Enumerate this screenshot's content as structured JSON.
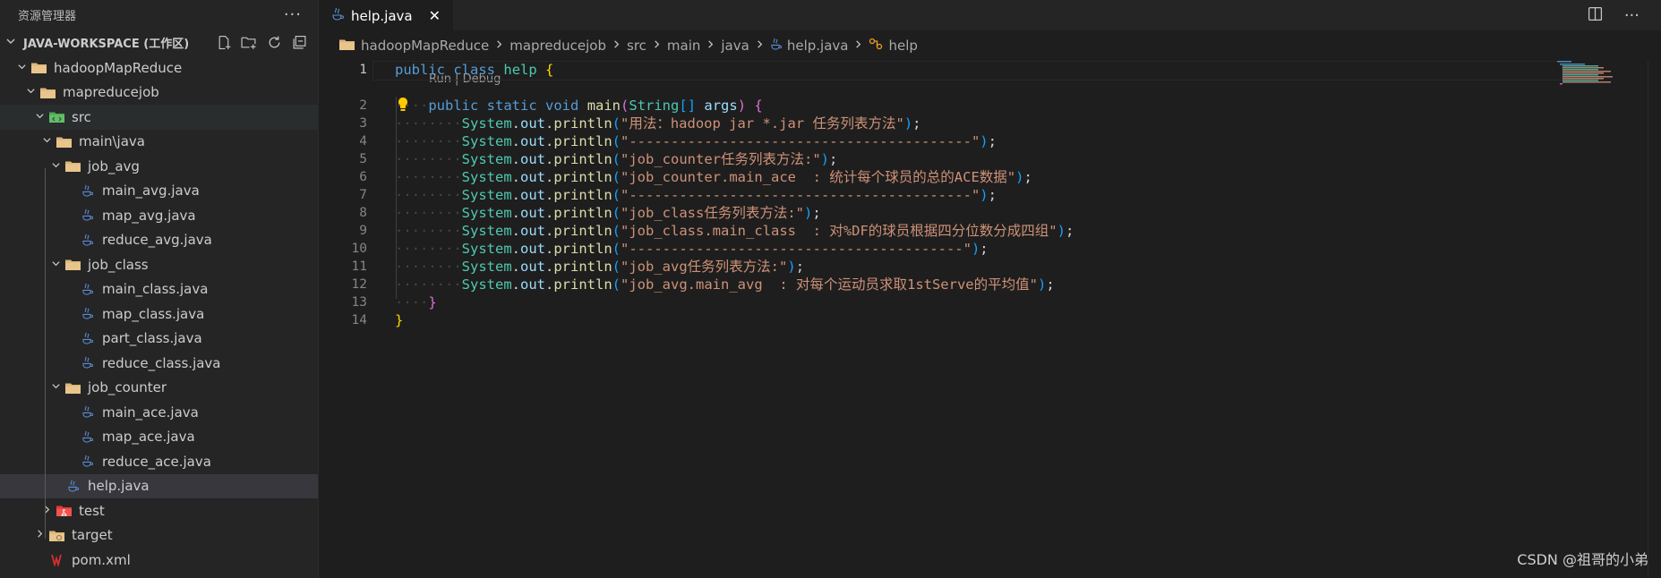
{
  "sidebar": {
    "title": "资源管理器",
    "more": "···",
    "workspace": "JAVA-WORKSPACE (工作区)",
    "tree": [
      {
        "label": "hadoopMapReduce",
        "depth": 0,
        "chevron": "open",
        "icon": "folder-icon"
      },
      {
        "label": "mapreducejob",
        "depth": 1,
        "chevron": "open",
        "icon": "folder-icon"
      },
      {
        "label": "src",
        "depth": 2,
        "chevron": "open",
        "icon": "folder-src-icon"
      },
      {
        "label": "main\\java",
        "depth": 3,
        "chevron": "open",
        "icon": "folder-icon"
      },
      {
        "label": "job_avg",
        "depth": 4,
        "chevron": "open",
        "icon": "folder-icon"
      },
      {
        "label": "main_avg.java",
        "depth": 5,
        "chevron": "",
        "icon": "java-icon"
      },
      {
        "label": "map_avg.java",
        "depth": 5,
        "chevron": "",
        "icon": "java-icon"
      },
      {
        "label": "reduce_avg.java",
        "depth": 5,
        "chevron": "",
        "icon": "java-icon"
      },
      {
        "label": "job_class",
        "depth": 4,
        "chevron": "open",
        "icon": "folder-icon"
      },
      {
        "label": "main_class.java",
        "depth": 5,
        "chevron": "",
        "icon": "java-icon"
      },
      {
        "label": "map_class.java",
        "depth": 5,
        "chevron": "",
        "icon": "java-icon"
      },
      {
        "label": "part_class.java",
        "depth": 5,
        "chevron": "",
        "icon": "java-icon"
      },
      {
        "label": "reduce_class.java",
        "depth": 5,
        "chevron": "",
        "icon": "java-icon"
      },
      {
        "label": "job_counter",
        "depth": 4,
        "chevron": "open",
        "icon": "folder-icon"
      },
      {
        "label": "main_ace.java",
        "depth": 5,
        "chevron": "",
        "icon": "java-icon"
      },
      {
        "label": "map_ace.java",
        "depth": 5,
        "chevron": "",
        "icon": "java-icon"
      },
      {
        "label": "reduce_ace.java",
        "depth": 5,
        "chevron": "",
        "icon": "java-icon"
      },
      {
        "label": "help.java",
        "depth": 4,
        "chevron": "",
        "icon": "java-icon",
        "selected": true
      },
      {
        "label": "test",
        "depth": 3,
        "chevron": "closed",
        "icon": "folder-test-icon"
      },
      {
        "label": "target",
        "depth": 2,
        "chevron": "closed",
        "icon": "folder-target-icon"
      },
      {
        "label": "pom.xml",
        "depth": 2,
        "chevron": "",
        "icon": "maven-icon"
      }
    ]
  },
  "editor": {
    "tab": {
      "label": "help.java",
      "close": "✕"
    },
    "breadcrumb": [
      "hadoopMapReduce",
      "mapreducejob",
      "src",
      "main",
      "java",
      "help.java",
      "help"
    ],
    "codelens": "Run | Debug",
    "lines": [
      {
        "n": "1",
        "tokens": [
          [
            "kw",
            "public"
          ],
          [
            "pn",
            " "
          ],
          [
            "kw",
            "class"
          ],
          [
            "pn",
            " "
          ],
          [
            "ty",
            "help"
          ],
          [
            "pn",
            " "
          ],
          [
            "br1",
            "{"
          ]
        ]
      },
      {
        "n": "2",
        "tokens": [
          [
            "dots",
            "····"
          ],
          [
            "kw",
            "public"
          ],
          [
            "pn",
            " "
          ],
          [
            "kw",
            "static"
          ],
          [
            "pn",
            " "
          ],
          [
            "kw",
            "void"
          ],
          [
            "pn",
            " "
          ],
          [
            "fn",
            "main"
          ],
          [
            "br2",
            "("
          ],
          [
            "ty",
            "String"
          ],
          [
            "br3",
            "[]"
          ],
          [
            "pn",
            " "
          ],
          [
            "var",
            "args"
          ],
          [
            "br2",
            ")"
          ],
          [
            "pn",
            " "
          ],
          [
            "br2",
            "{"
          ]
        ]
      },
      {
        "n": "3",
        "tokens": [
          [
            "dots",
            "········"
          ],
          [
            "ty",
            "System"
          ],
          [
            "pn",
            "."
          ],
          [
            "var",
            "out"
          ],
          [
            "pn",
            "."
          ],
          [
            "fn",
            "println"
          ],
          [
            "br3",
            "("
          ],
          [
            "str",
            "\"用法：hadoop jar *.jar 任务列表方法\""
          ],
          [
            "br3",
            ")"
          ],
          [
            "pn",
            ";"
          ]
        ]
      },
      {
        "n": "4",
        "tokens": [
          [
            "dots",
            "········"
          ],
          [
            "ty",
            "System"
          ],
          [
            "pn",
            "."
          ],
          [
            "var",
            "out"
          ],
          [
            "pn",
            "."
          ],
          [
            "fn",
            "println"
          ],
          [
            "br3",
            "("
          ],
          [
            "str",
            "\"-----------------------------------------\""
          ],
          [
            "br3",
            ")"
          ],
          [
            "pn",
            ";"
          ]
        ]
      },
      {
        "n": "5",
        "tokens": [
          [
            "dots",
            "········"
          ],
          [
            "ty",
            "System"
          ],
          [
            "pn",
            "."
          ],
          [
            "var",
            "out"
          ],
          [
            "pn",
            "."
          ],
          [
            "fn",
            "println"
          ],
          [
            "br3",
            "("
          ],
          [
            "str",
            "\"job_counter任务列表方法:\""
          ],
          [
            "br3",
            ")"
          ],
          [
            "pn",
            ";"
          ]
        ]
      },
      {
        "n": "6",
        "tokens": [
          [
            "dots",
            "········"
          ],
          [
            "ty",
            "System"
          ],
          [
            "pn",
            "."
          ],
          [
            "var",
            "out"
          ],
          [
            "pn",
            "."
          ],
          [
            "fn",
            "println"
          ],
          [
            "br3",
            "("
          ],
          [
            "str",
            "\"job_counter.main_ace  : 统计每个球员的总的ACE数据\""
          ],
          [
            "br3",
            ")"
          ],
          [
            "pn",
            ";"
          ]
        ]
      },
      {
        "n": "7",
        "tokens": [
          [
            "dots",
            "········"
          ],
          [
            "ty",
            "System"
          ],
          [
            "pn",
            "."
          ],
          [
            "var",
            "out"
          ],
          [
            "pn",
            "."
          ],
          [
            "fn",
            "println"
          ],
          [
            "br3",
            "("
          ],
          [
            "str",
            "\"-----------------------------------------\""
          ],
          [
            "br3",
            ")"
          ],
          [
            "pn",
            ";"
          ]
        ]
      },
      {
        "n": "8",
        "tokens": [
          [
            "dots",
            "········"
          ],
          [
            "ty",
            "System"
          ],
          [
            "pn",
            "."
          ],
          [
            "var",
            "out"
          ],
          [
            "pn",
            "."
          ],
          [
            "fn",
            "println"
          ],
          [
            "br3",
            "("
          ],
          [
            "str",
            "\"job_class任务列表方法:\""
          ],
          [
            "br3",
            ")"
          ],
          [
            "pn",
            ";"
          ]
        ]
      },
      {
        "n": "9",
        "tokens": [
          [
            "dots",
            "········"
          ],
          [
            "ty",
            "System"
          ],
          [
            "pn",
            "."
          ],
          [
            "var",
            "out"
          ],
          [
            "pn",
            "."
          ],
          [
            "fn",
            "println"
          ],
          [
            "br3",
            "("
          ],
          [
            "str",
            "\"job_class.main_class  : 对%DF的球员根据四分位数分成四组\""
          ],
          [
            "br3",
            ")"
          ],
          [
            "pn",
            ";"
          ]
        ]
      },
      {
        "n": "10",
        "tokens": [
          [
            "dots",
            "········"
          ],
          [
            "ty",
            "System"
          ],
          [
            "pn",
            "."
          ],
          [
            "var",
            "out"
          ],
          [
            "pn",
            "."
          ],
          [
            "fn",
            "println"
          ],
          [
            "br3",
            "("
          ],
          [
            "str",
            "\"----------------------------------------\""
          ],
          [
            "br3",
            ")"
          ],
          [
            "pn",
            ";"
          ]
        ]
      },
      {
        "n": "11",
        "tokens": [
          [
            "dots",
            "········"
          ],
          [
            "ty",
            "System"
          ],
          [
            "pn",
            "."
          ],
          [
            "var",
            "out"
          ],
          [
            "pn",
            "."
          ],
          [
            "fn",
            "println"
          ],
          [
            "br3",
            "("
          ],
          [
            "str",
            "\"job_avg任务列表方法:\""
          ],
          [
            "br3",
            ")"
          ],
          [
            "pn",
            ";"
          ]
        ]
      },
      {
        "n": "12",
        "tokens": [
          [
            "dots",
            "········"
          ],
          [
            "ty",
            "System"
          ],
          [
            "pn",
            "."
          ],
          [
            "var",
            "out"
          ],
          [
            "pn",
            "."
          ],
          [
            "fn",
            "println"
          ],
          [
            "br3",
            "("
          ],
          [
            "str",
            "\"job_avg.main_avg  : 对每个运动员求取1stServe的平均值\""
          ],
          [
            "br3",
            ")"
          ],
          [
            "pn",
            ";"
          ]
        ]
      },
      {
        "n": "13",
        "tokens": [
          [
            "dots",
            "····"
          ],
          [
            "br2",
            "}"
          ]
        ]
      },
      {
        "n": "14",
        "tokens": [
          [
            "br1",
            "}"
          ]
        ]
      }
    ]
  },
  "watermark": "CSDN @祖哥的小弟",
  "colors": {
    "folder": "#dcb67a",
    "java": "#5b8dd6",
    "src_folder": "#4caf50",
    "test_folder": "#e53935",
    "maven": "#d32f2f"
  }
}
